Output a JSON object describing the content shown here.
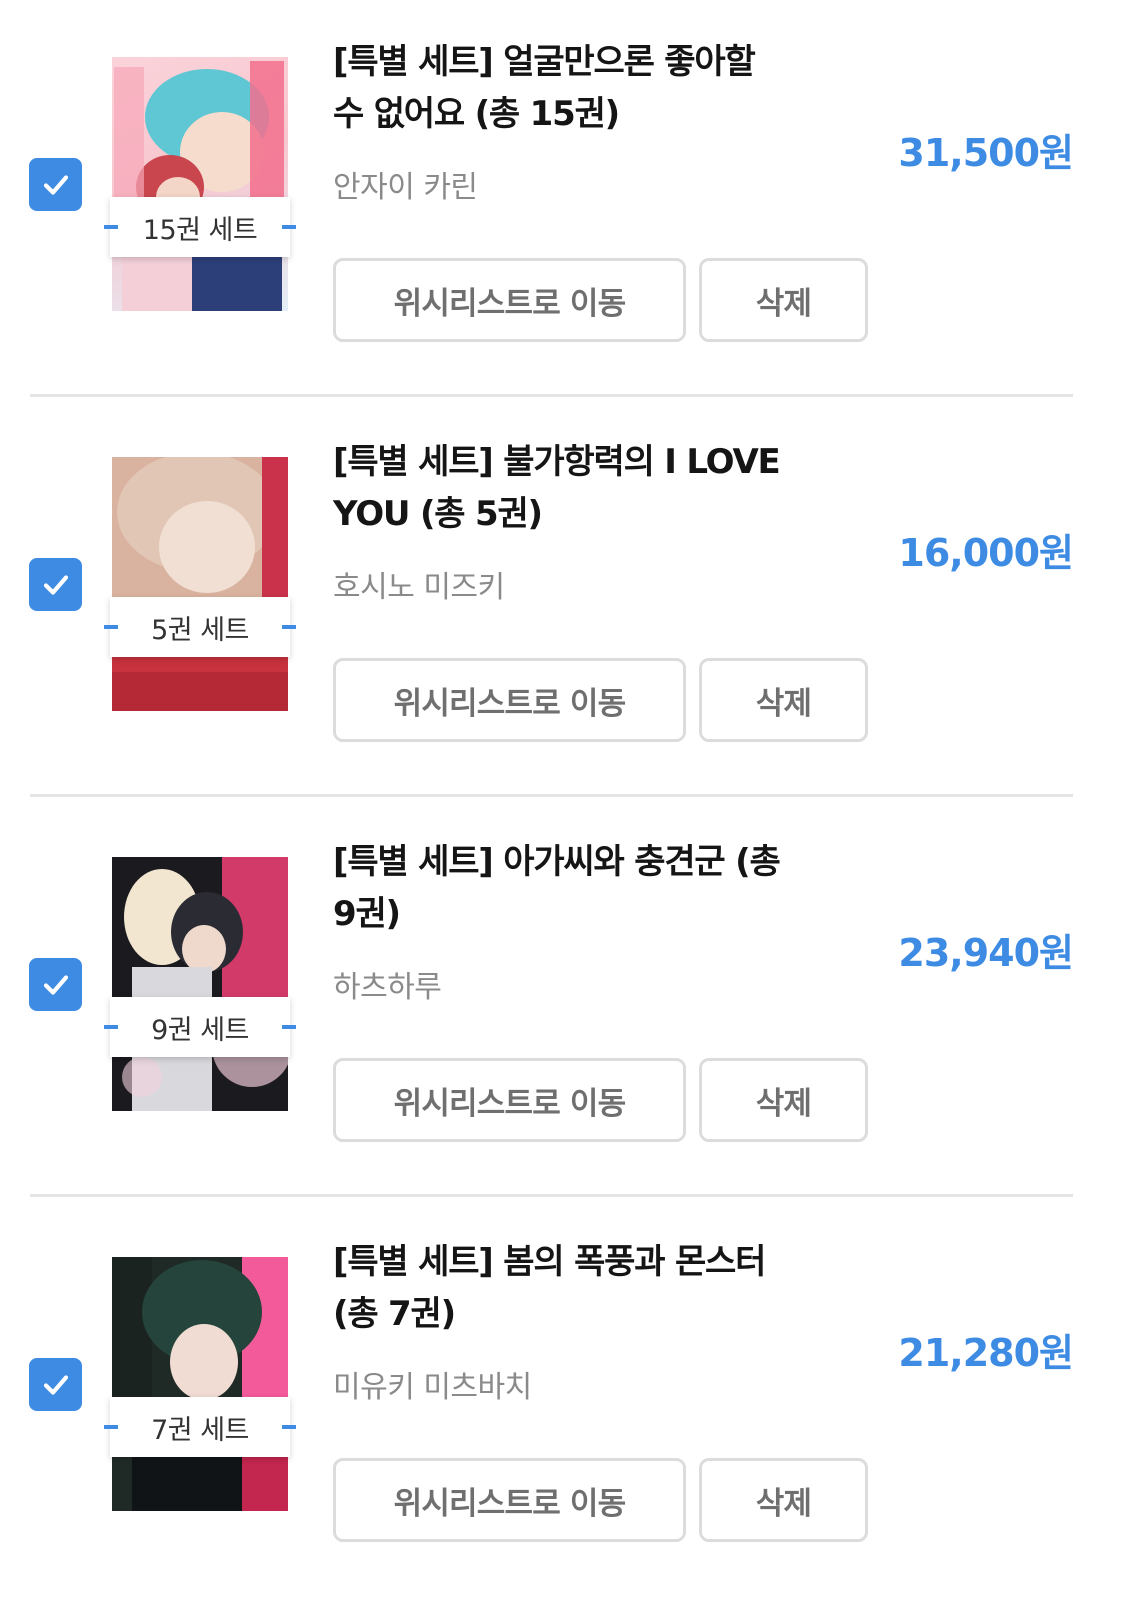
{
  "colors": {
    "accent": "#3d8be3",
    "price": "#3d8be3",
    "divider": "#e5e5e5",
    "button_border": "#dcdcdc",
    "author_text": "#8a8a8a"
  },
  "icons": {
    "checkbox": "checkmark-icon"
  },
  "cart": {
    "items": [
      {
        "checked": true,
        "title": "[특별 세트] 얼굴만으론 좋아할 수 없어요 (총 15권)",
        "author": "안자이 카린",
        "price": "31,500원",
        "set_badge": "15권 세트",
        "wishlist_label": "위시리스트로 이동",
        "delete_label": "삭제"
      },
      {
        "checked": true,
        "title": "[특별 세트] 불가항력의 I LOVE YOU (총 5권)",
        "author": "호시노 미즈키",
        "price": "16,000원",
        "set_badge": "5권 세트",
        "wishlist_label": "위시리스트로 이동",
        "delete_label": "삭제"
      },
      {
        "checked": true,
        "title": "[특별 세트] 아가씨와 충견군 (총 9권)",
        "author": "하츠하루",
        "price": "23,940원",
        "set_badge": "9권 세트",
        "wishlist_label": "위시리스트로 이동",
        "delete_label": "삭제"
      },
      {
        "checked": true,
        "title": "[특별 세트] 봄의 폭풍과 몬스터 (총 7권)",
        "author": "미유키 미츠바치",
        "price": "21,280원",
        "set_badge": "7권 세트",
        "wishlist_label": "위시리스트로 이동",
        "delete_label": "삭제"
      }
    ]
  }
}
